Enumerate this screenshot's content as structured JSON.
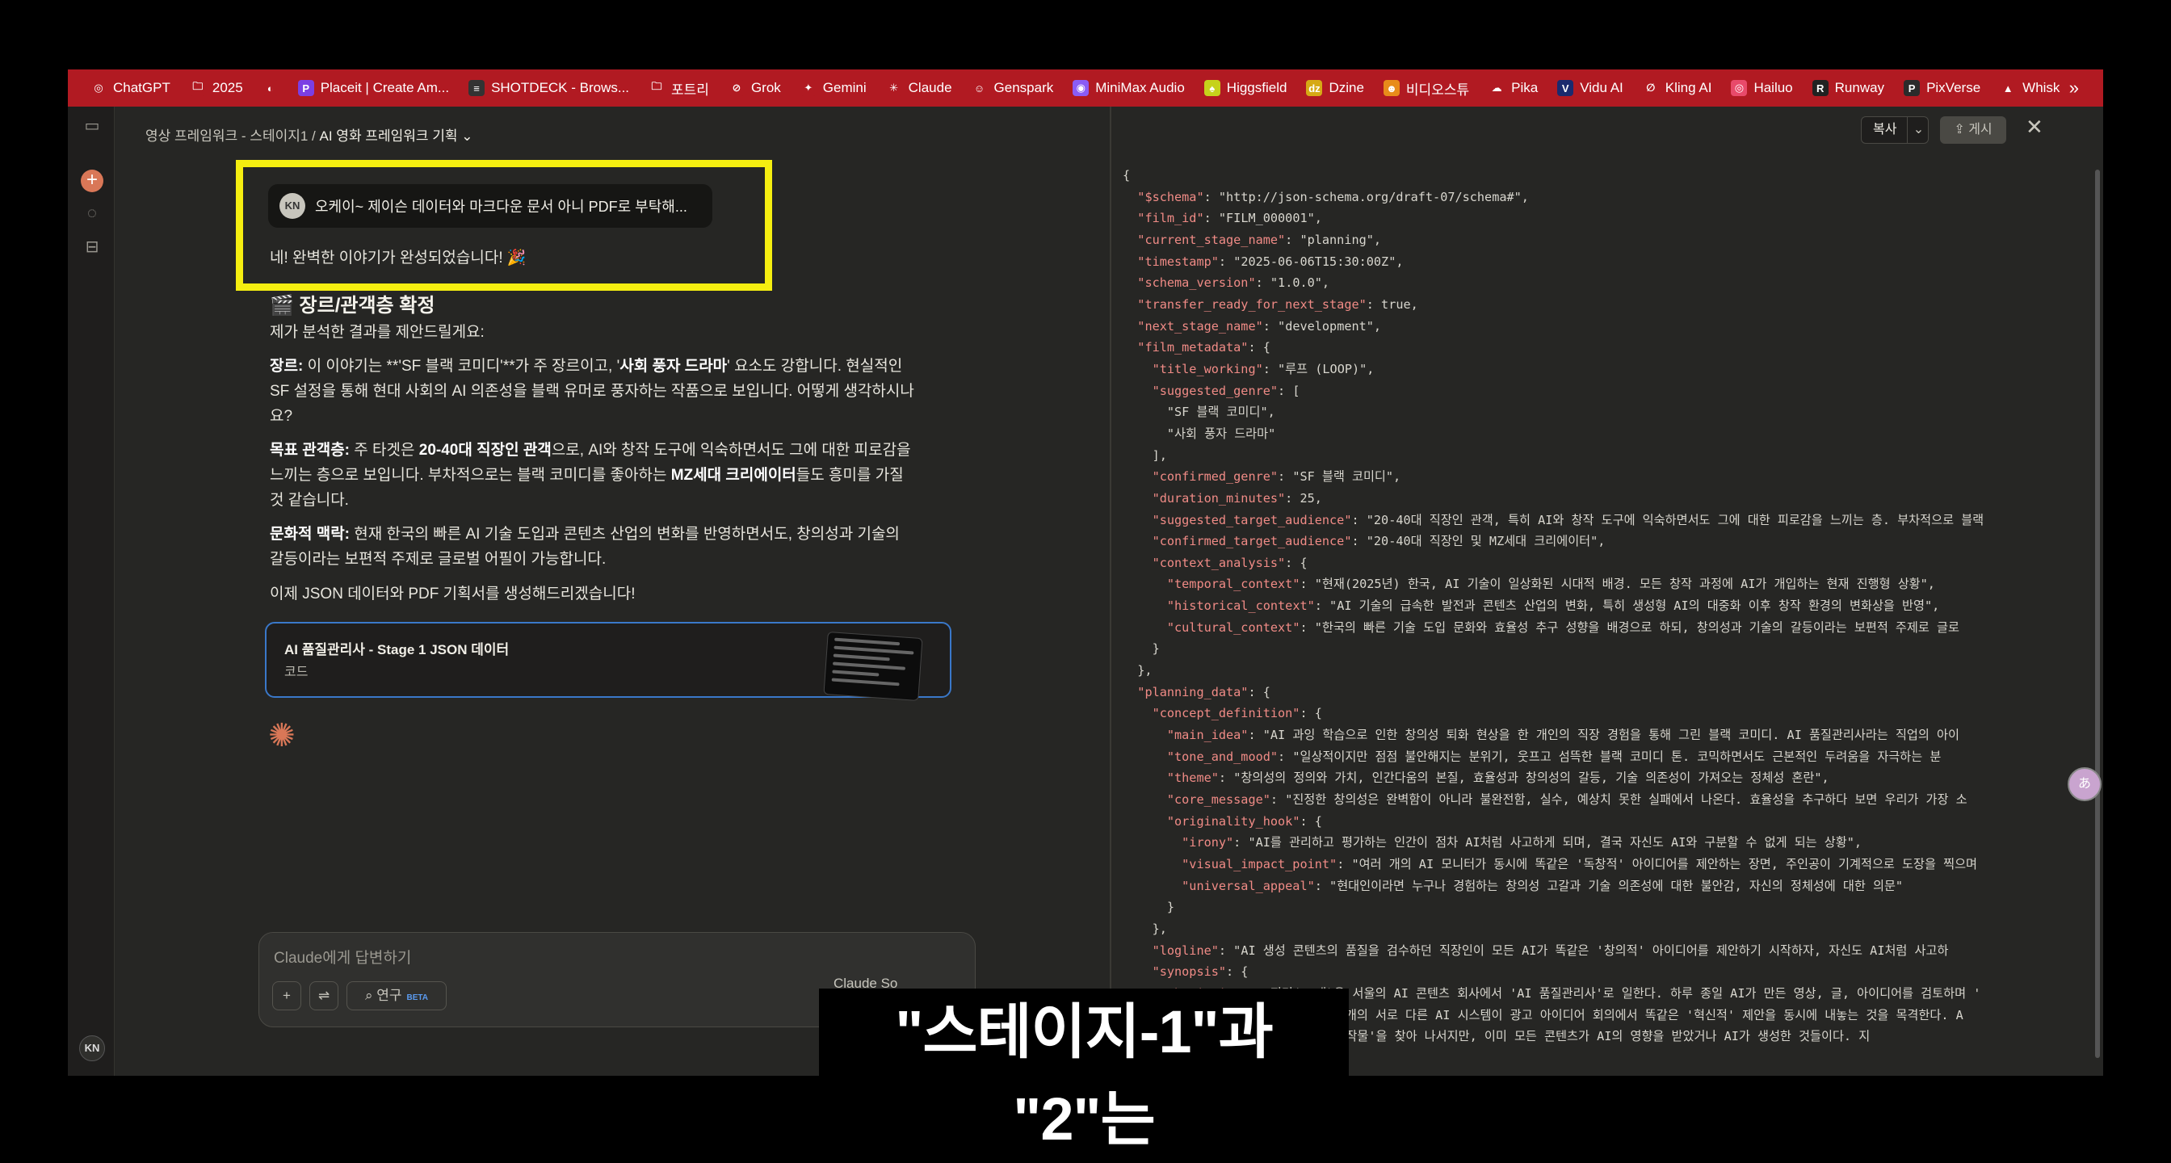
{
  "bookmarks": {
    "items": [
      {
        "label": "ChatGPT",
        "icon": "chatgpt-icon",
        "glyph": "◎",
        "color": "#b11a22"
      },
      {
        "label": "2025",
        "icon": "folder-icon",
        "glyph": "🗀",
        "color": "#b11a22"
      },
      {
        "label": "",
        "icon": "site-icon",
        "glyph": "◐",
        "color": "#b11a22"
      },
      {
        "label": "Placeit | Create Am...",
        "icon": "placeit-icon",
        "glyph": "P",
        "color": "#7b3fe4"
      },
      {
        "label": "SHOTDECK - Brows...",
        "icon": "shotdeck-icon",
        "glyph": "≡",
        "color": "#333333"
      },
      {
        "label": "포트리",
        "icon": "folder-icon",
        "glyph": "🗀",
        "color": "#b11a22"
      },
      {
        "label": "Grok",
        "icon": "grok-icon",
        "glyph": "⊘",
        "color": "#b11a22"
      },
      {
        "label": "Gemini",
        "icon": "gemini-icon",
        "glyph": "✦",
        "color": "#b11a22"
      },
      {
        "label": "Claude",
        "icon": "claude-icon",
        "glyph": "✳",
        "color": "#b11a22"
      },
      {
        "label": "Genspark",
        "icon": "genspark-icon",
        "glyph": "☺",
        "color": "#b11a22"
      },
      {
        "label": "MiniMax Audio",
        "icon": "minimax-icon",
        "glyph": "◉",
        "color": "#8a5cf5"
      },
      {
        "label": "Higgsfield",
        "icon": "higgsfield-icon",
        "glyph": "♠",
        "color": "#c6d21b"
      },
      {
        "label": "Dzine",
        "icon": "dzine-icon",
        "glyph": "dz",
        "color": "#d6a915"
      },
      {
        "label": "비디오스튜",
        "icon": "videostudio-icon",
        "glyph": "☻",
        "color": "#e88c1a"
      },
      {
        "label": "Pika",
        "icon": "pika-icon",
        "glyph": "☁",
        "color": "#b11a22"
      },
      {
        "label": "Vidu AI",
        "icon": "vidu-icon",
        "glyph": "V",
        "color": "#1a2a6e"
      },
      {
        "label": "Kling AI",
        "icon": "kling-icon",
        "glyph": "∅",
        "color": "#b11a22"
      },
      {
        "label": "Hailuo",
        "icon": "hailuo-icon",
        "glyph": "◎",
        "color": "#e84a6a"
      },
      {
        "label": "Runway",
        "icon": "runway-icon",
        "glyph": "R",
        "color": "#222222"
      },
      {
        "label": "PixVerse",
        "icon": "pixverse-icon",
        "glyph": "P",
        "color": "#2b2b2b"
      },
      {
        "label": "Whisk",
        "icon": "whisk-icon",
        "glyph": "▲",
        "color": "#b11a22"
      }
    ],
    "more": "»"
  },
  "sidebar": {
    "avatar": "KN"
  },
  "chat": {
    "breadcrumb_project": "영상 프레임워크 - 스테이지1 /",
    "breadcrumb_title": "AI 영화 프레임워크 기획 ⌄",
    "user_avatar": "KN",
    "user_message": "오케이~ 제이슨 데이터와 마크다운 문서 아니 PDF로 부탁해...",
    "reply_intro": "네! 완벽한 이야기가 완성되었습니다! 🎉",
    "heading": "🎬 장르/관객층 확정",
    "lead": "제가 분석한 결과를 제안드릴게요:",
    "genre_label": "장르:",
    "genre_text": " 이 이야기는 **'SF 블랙 코미디'**가 주 장르이고, '",
    "genre_bold": "사회 풍자 드라마",
    "genre_text2": "' 요소도 강합니다. 현실적인 SF 설정을 통해 현대 사회의 AI 의존성을 블랙 유머로 풍자하는 작품으로 보입니다. 어떻게 생각하시나요?",
    "audience_label": "목표 관객층:",
    "audience_text1": " 주 타겟은 ",
    "audience_bold1": "20-40대 직장인 관객",
    "audience_text2": "으로, AI와 창작 도구에 익숙하면서도 그에 대한 피로감을 느끼는 층으로 보입니다. 부차적으로는 블랙 코미디를 좋아하는 ",
    "audience_bold2": "MZ세대 크리에이터",
    "audience_text3": "들도 흥미를 가질 것 같습니다.",
    "context_label": "문화적 맥락:",
    "context_text": " 현재 한국의 빠른 AI 기술 도입과 콘텐츠 산업의 변화를 반영하면서도, 창의성과 기술의 갈등이라는 보편적 주제로 글로벌 어필이 가능합니다.",
    "closing": "이제 JSON 데이터와 PDF 기획서를 생성해드리겠습니다!",
    "artifact_title": "AI 품질관리사 - Stage 1 JSON 데이터",
    "artifact_sub": "코드",
    "composer_placeholder": "Claude에게 답변하기",
    "research_label": "연구",
    "beta_label": "BETA",
    "model_label": "Claude So"
  },
  "code_panel": {
    "copy_label": "복사",
    "publish_label": "⇪ 게시",
    "close": "✕",
    "lines": [
      [
        [
          "p",
          "{"
        ]
      ],
      [
        [
          "p",
          "  "
        ],
        [
          "k",
          "\"$schema\""
        ],
        [
          "p",
          ": "
        ],
        [
          "s",
          "\"http://json-schema.org/draft-07/schema#\","
        ]
      ],
      [
        [
          "p",
          "  "
        ],
        [
          "k",
          "\"film_id\""
        ],
        [
          "p",
          ": "
        ],
        [
          "s",
          "\"FILM_000001\","
        ]
      ],
      [
        [
          "p",
          "  "
        ],
        [
          "k",
          "\"current_stage_name\""
        ],
        [
          "p",
          ": "
        ],
        [
          "s",
          "\"planning\","
        ]
      ],
      [
        [
          "p",
          "  "
        ],
        [
          "k",
          "\"timestamp\""
        ],
        [
          "p",
          ": "
        ],
        [
          "s",
          "\"2025-06-06T15:30:00Z\","
        ]
      ],
      [
        [
          "p",
          "  "
        ],
        [
          "k",
          "\"schema_version\""
        ],
        [
          "p",
          ": "
        ],
        [
          "s",
          "\"1.0.0\","
        ]
      ],
      [
        [
          "p",
          "  "
        ],
        [
          "k",
          "\"transfer_ready_for_next_stage\""
        ],
        [
          "p",
          ": "
        ],
        [
          "s",
          "true,"
        ]
      ],
      [
        [
          "p",
          "  "
        ],
        [
          "k",
          "\"next_stage_name\""
        ],
        [
          "p",
          ": "
        ],
        [
          "s",
          "\"development\","
        ]
      ],
      [
        [
          "p",
          "  "
        ],
        [
          "k",
          "\"film_metadata\""
        ],
        [
          "p",
          ": {"
        ]
      ],
      [
        [
          "p",
          "    "
        ],
        [
          "k",
          "\"title_working\""
        ],
        [
          "p",
          ": "
        ],
        [
          "s",
          "\"루프 (LOOP)\","
        ]
      ],
      [
        [
          "p",
          "    "
        ],
        [
          "k",
          "\"suggested_genre\""
        ],
        [
          "p",
          ": ["
        ]
      ],
      [
        [
          "p",
          "      "
        ],
        [
          "s",
          "\"SF 블랙 코미디\","
        ]
      ],
      [
        [
          "p",
          "      "
        ],
        [
          "s",
          "\"사회 풍자 드라마\""
        ]
      ],
      [
        [
          "p",
          "    ],"
        ]
      ],
      [
        [
          "p",
          "    "
        ],
        [
          "k",
          "\"confirmed_genre\""
        ],
        [
          "p",
          ": "
        ],
        [
          "s",
          "\"SF 블랙 코미디\","
        ]
      ],
      [
        [
          "p",
          "    "
        ],
        [
          "k",
          "\"duration_minutes\""
        ],
        [
          "p",
          ": "
        ],
        [
          "s",
          "25,"
        ]
      ],
      [
        [
          "p",
          "    "
        ],
        [
          "k",
          "\"suggested_target_audience\""
        ],
        [
          "p",
          ": "
        ],
        [
          "s",
          "\"20-40대 직장인 관객, 특히 AI와 창작 도구에 익숙하면서도 그에 대한 피로감을 느끼는 층. 부차적으로 블랙"
        ]
      ],
      [
        [
          "p",
          "    "
        ],
        [
          "k",
          "\"confirmed_target_audience\""
        ],
        [
          "p",
          ": "
        ],
        [
          "s",
          "\"20-40대 직장인 및 MZ세대 크리에이터\","
        ]
      ],
      [
        [
          "p",
          "    "
        ],
        [
          "k",
          "\"context_analysis\""
        ],
        [
          "p",
          ": {"
        ]
      ],
      [
        [
          "p",
          "      "
        ],
        [
          "k",
          "\"temporal_context\""
        ],
        [
          "p",
          ": "
        ],
        [
          "s",
          "\"현재(2025년) 한국, AI 기술이 일상화된 시대적 배경. 모든 창작 과정에 AI가 개입하는 현재 진행형 상황\","
        ]
      ],
      [
        [
          "p",
          "      "
        ],
        [
          "k",
          "\"historical_context\""
        ],
        [
          "p",
          ": "
        ],
        [
          "s",
          "\"AI 기술의 급속한 발전과 콘텐츠 산업의 변화, 특히 생성형 AI의 대중화 이후 창작 환경의 변화상을 반영\","
        ]
      ],
      [
        [
          "p",
          "      "
        ],
        [
          "k",
          "\"cultural_context\""
        ],
        [
          "p",
          ": "
        ],
        [
          "s",
          "\"한국의 빠른 기술 도입 문화와 효율성 추구 성향을 배경으로 하되, 창의성과 기술의 갈등이라는 보편적 주제로 글로"
        ]
      ],
      [
        [
          "p",
          "    }"
        ]
      ],
      [
        [
          "p",
          "  },"
        ]
      ],
      [
        [
          "p",
          "  "
        ],
        [
          "k",
          "\"planning_data\""
        ],
        [
          "p",
          ": {"
        ]
      ],
      [
        [
          "p",
          "    "
        ],
        [
          "k",
          "\"concept_definition\""
        ],
        [
          "p",
          ": {"
        ]
      ],
      [
        [
          "p",
          "      "
        ],
        [
          "k",
          "\"main_idea\""
        ],
        [
          "p",
          ": "
        ],
        [
          "s",
          "\"AI 과잉 학습으로 인한 창의성 퇴화 현상을 한 개인의 직장 경험을 통해 그린 블랙 코미디. AI 품질관리사라는 직업의 아이"
        ]
      ],
      [
        [
          "p",
          "      "
        ],
        [
          "k",
          "\"tone_and_mood\""
        ],
        [
          "p",
          ": "
        ],
        [
          "s",
          "\"일상적이지만 점점 불안해지는 분위기, 웃프고 섬뜩한 블랙 코미디 톤. 코믹하면서도 근본적인 두려움을 자극하는 분"
        ]
      ],
      [
        [
          "p",
          "      "
        ],
        [
          "k",
          "\"theme\""
        ],
        [
          "p",
          ": "
        ],
        [
          "s",
          "\"창의성의 정의와 가치, 인간다움의 본질, 효율성과 창의성의 갈등, 기술 의존성이 가져오는 정체성 혼란\","
        ]
      ],
      [
        [
          "p",
          "      "
        ],
        [
          "k",
          "\"core_message\""
        ],
        [
          "p",
          ": "
        ],
        [
          "s",
          "\"진정한 창의성은 완벽함이 아니라 불완전함, 실수, 예상치 못한 실패에서 나온다. 효율성을 추구하다 보면 우리가 가장 소"
        ]
      ],
      [
        [
          "p",
          "      "
        ],
        [
          "k",
          "\"originality_hook\""
        ],
        [
          "p",
          ": {"
        ]
      ],
      [
        [
          "p",
          "        "
        ],
        [
          "k",
          "\"irony\""
        ],
        [
          "p",
          ": "
        ],
        [
          "s",
          "\"AI를 관리하고 평가하는 인간이 점차 AI처럼 사고하게 되며, 결국 자신도 AI와 구분할 수 없게 되는 상황\","
        ]
      ],
      [
        [
          "p",
          "        "
        ],
        [
          "k",
          "\"visual_impact_point\""
        ],
        [
          "p",
          ": "
        ],
        [
          "s",
          "\"여러 개의 AI 모니터가 동시에 똑같은 '독창적' 아이디어를 제안하는 장면, 주인공이 기계적으로 도장을 찍으며"
        ]
      ],
      [
        [
          "p",
          "        "
        ],
        [
          "k",
          "\"universal_appeal\""
        ],
        [
          "p",
          ": "
        ],
        [
          "s",
          "\"현대인이라면 누구나 경험하는 창의성 고갈과 기술 의존성에 대한 불안감, 자신의 정체성에 대한 의문\""
        ]
      ],
      [
        [
          "p",
          "      }"
        ]
      ],
      [
        [
          "p",
          "    },"
        ]
      ],
      [
        [
          "p",
          "    "
        ],
        [
          "k",
          "\"logline\""
        ],
        [
          "p",
          ": "
        ],
        [
          "s",
          "\"AI 생성 콘텐츠의 품질을 검수하던 직장인이 모든 AI가 똑같은 '창의적' 아이디어를 제안하기 시작하자, 자신도 AI처럼 사고하"
        ]
      ],
      [
        [
          "p",
          "    "
        ],
        [
          "k",
          "\"synopsis\""
        ],
        [
          "p",
          ": {"
        ]
      ],
      [
        [
          "p",
          "      "
        ],
        [
          "k",
          "\"beginning\""
        ],
        [
          "p",
          ": "
        ],
        [
          "s",
          "\"지민(30대)은 서울의 AI 콘텐츠 회사에서 'AI 품질관리사'로 일한다. 하루 종일 AI가 만든 영상, 글, 아이디어를 검토하며 '"
        ]
      ],
      [
        [
          "p",
          "      "
        ],
        [
          "k",
          "\"middle\""
        ],
        [
          "p",
          ": "
        ],
        [
          "s",
          "\"어느 날 지민은 5개의 서로 다른 AI 시스템이 광고 아이디어 회의에서 똑같은 '혁신적' 제안을 동시에 내놓는 것을 목격한다. A"
        ]
      ],
      [
        [
          "p",
          "      "
        ],
        [
          "k",
          "\"end\""
        ],
        [
          "p",
          ": "
        ],
        [
          "s",
          "\"지민은 '순수 인간 창작물'을 찾아 나서지만, 이미 모든 콘텐츠가 AI의 영향을 받았거나 AI가 생성한 것들이다. 지"
        ]
      ]
    ]
  },
  "overlay": {
    "subtitle": "\"스테이지-1\"과 \"2\"는",
    "float_icon": "あ"
  }
}
